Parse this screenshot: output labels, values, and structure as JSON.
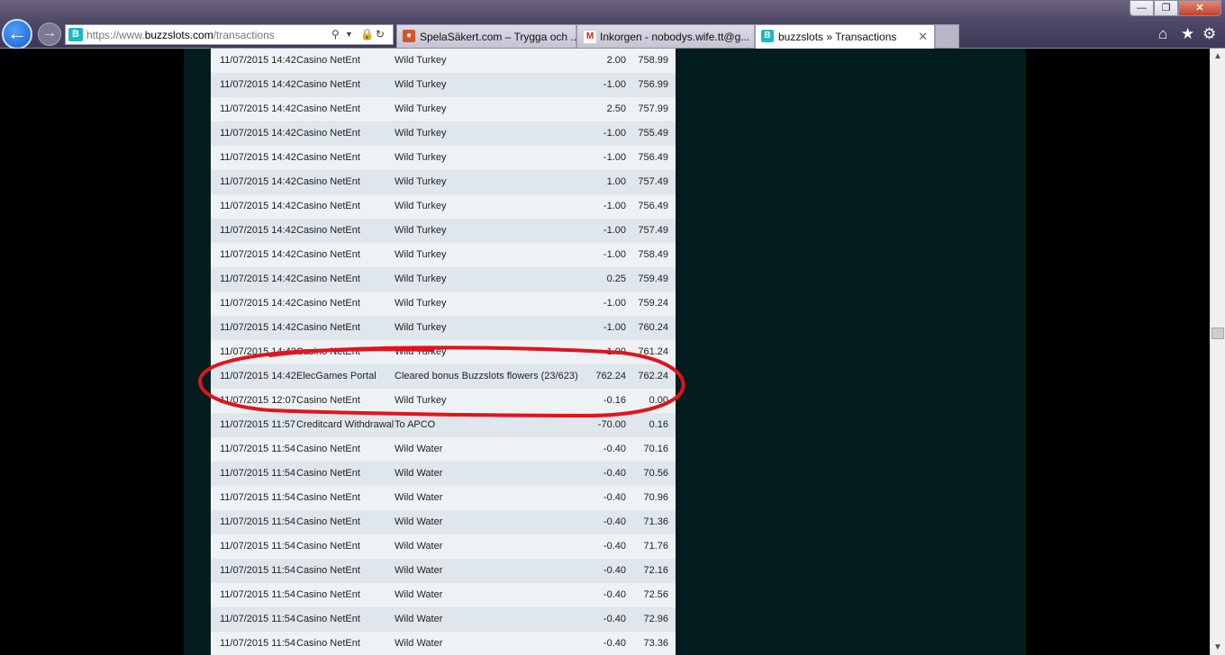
{
  "browser": {
    "url_prefix": "https://www.",
    "url_domain": "buzzslots.com",
    "url_path": "/transactions",
    "tabs": [
      {
        "label": "SpelaSäkert.com – Trygga och ...",
        "favicon_color": "#d9542b"
      },
      {
        "label": "Inkorgen - nobodys.wife.tt@g...",
        "favicon_color": "#c5221f"
      },
      {
        "label": "buzzslots » Transactions",
        "favicon_color": "#1cb8c4"
      }
    ],
    "window_buttons": {
      "minimize": "—",
      "maximize": "❐",
      "close": "✕"
    },
    "icons": {
      "home": "⌂",
      "favorites": "★",
      "settings": "⚙"
    }
  },
  "transactions": [
    {
      "date": "11/07/2015 14:42",
      "type": "Casino NetEnt",
      "description": "Wild Turkey",
      "amount": "2.00",
      "balance": "758.99"
    },
    {
      "date": "11/07/2015 14:42",
      "type": "Casino NetEnt",
      "description": "Wild Turkey",
      "amount": "-1.00",
      "balance": "756.99"
    },
    {
      "date": "11/07/2015 14:42",
      "type": "Casino NetEnt",
      "description": "Wild Turkey",
      "amount": "2.50",
      "balance": "757.99"
    },
    {
      "date": "11/07/2015 14:42",
      "type": "Casino NetEnt",
      "description": "Wild Turkey",
      "amount": "-1.00",
      "balance": "755.49"
    },
    {
      "date": "11/07/2015 14:42",
      "type": "Casino NetEnt",
      "description": "Wild Turkey",
      "amount": "-1.00",
      "balance": "756.49"
    },
    {
      "date": "11/07/2015 14:42",
      "type": "Casino NetEnt",
      "description": "Wild Turkey",
      "amount": "1.00",
      "balance": "757.49"
    },
    {
      "date": "11/07/2015 14:42",
      "type": "Casino NetEnt",
      "description": "Wild Turkey",
      "amount": "-1.00",
      "balance": "756.49"
    },
    {
      "date": "11/07/2015 14:42",
      "type": "Casino NetEnt",
      "description": "Wild Turkey",
      "amount": "-1.00",
      "balance": "757.49"
    },
    {
      "date": "11/07/2015 14:42",
      "type": "Casino NetEnt",
      "description": "Wild Turkey",
      "amount": "-1.00",
      "balance": "758.49"
    },
    {
      "date": "11/07/2015 14:42",
      "type": "Casino NetEnt",
      "description": "Wild Turkey",
      "amount": "0.25",
      "balance": "759.49"
    },
    {
      "date": "11/07/2015 14:42",
      "type": "Casino NetEnt",
      "description": "Wild Turkey",
      "amount": "-1.00",
      "balance": "759.24"
    },
    {
      "date": "11/07/2015 14:42",
      "type": "Casino NetEnt",
      "description": "Wild Turkey",
      "amount": "-1.00",
      "balance": "760.24"
    },
    {
      "date": "11/07/2015 14:42",
      "type": "Casino NetEnt",
      "description": "Wild Turkey",
      "amount": "-1.00",
      "balance": "761.24"
    },
    {
      "date": "11/07/2015 14:42",
      "type": "ElecGames Portal",
      "description": "Cleared bonus Buzzslots flowers (23/623)",
      "amount": "762.24",
      "balance": "762.24"
    },
    {
      "date": "11/07/2015 12:07",
      "type": "Casino NetEnt",
      "description": "Wild Turkey",
      "amount": "-0.16",
      "balance": "0.00"
    },
    {
      "date": "11/07/2015 11:57",
      "type": "Creditcard Withdrawal",
      "description": "To APCO",
      "amount": "-70.00",
      "balance": "0.16"
    },
    {
      "date": "11/07/2015 11:54",
      "type": "Casino NetEnt",
      "description": "Wild Water",
      "amount": "-0.40",
      "balance": "70.16"
    },
    {
      "date": "11/07/2015 11:54",
      "type": "Casino NetEnt",
      "description": "Wild Water",
      "amount": "-0.40",
      "balance": "70.56"
    },
    {
      "date": "11/07/2015 11:54",
      "type": "Casino NetEnt",
      "description": "Wild Water",
      "amount": "-0.40",
      "balance": "70.96"
    },
    {
      "date": "11/07/2015 11:54",
      "type": "Casino NetEnt",
      "description": "Wild Water",
      "amount": "-0.40",
      "balance": "71.36"
    },
    {
      "date": "11/07/2015 11:54",
      "type": "Casino NetEnt",
      "description": "Wild Water",
      "amount": "-0.40",
      "balance": "71.76"
    },
    {
      "date": "11/07/2015 11:54",
      "type": "Casino NetEnt",
      "description": "Wild Water",
      "amount": "-0.40",
      "balance": "72.16"
    },
    {
      "date": "11/07/2015 11:54",
      "type": "Casino NetEnt",
      "description": "Wild Water",
      "amount": "-0.40",
      "balance": "72.56"
    },
    {
      "date": "11/07/2015 11:54",
      "type": "Casino NetEnt",
      "description": "Wild Water",
      "amount": "-0.40",
      "balance": "72.96"
    },
    {
      "date": "11/07/2015 11:54",
      "type": "Casino NetEnt",
      "description": "Wild Water",
      "amount": "-0.40",
      "balance": "73.36"
    }
  ],
  "annotation": {
    "color": "#e0141e"
  }
}
